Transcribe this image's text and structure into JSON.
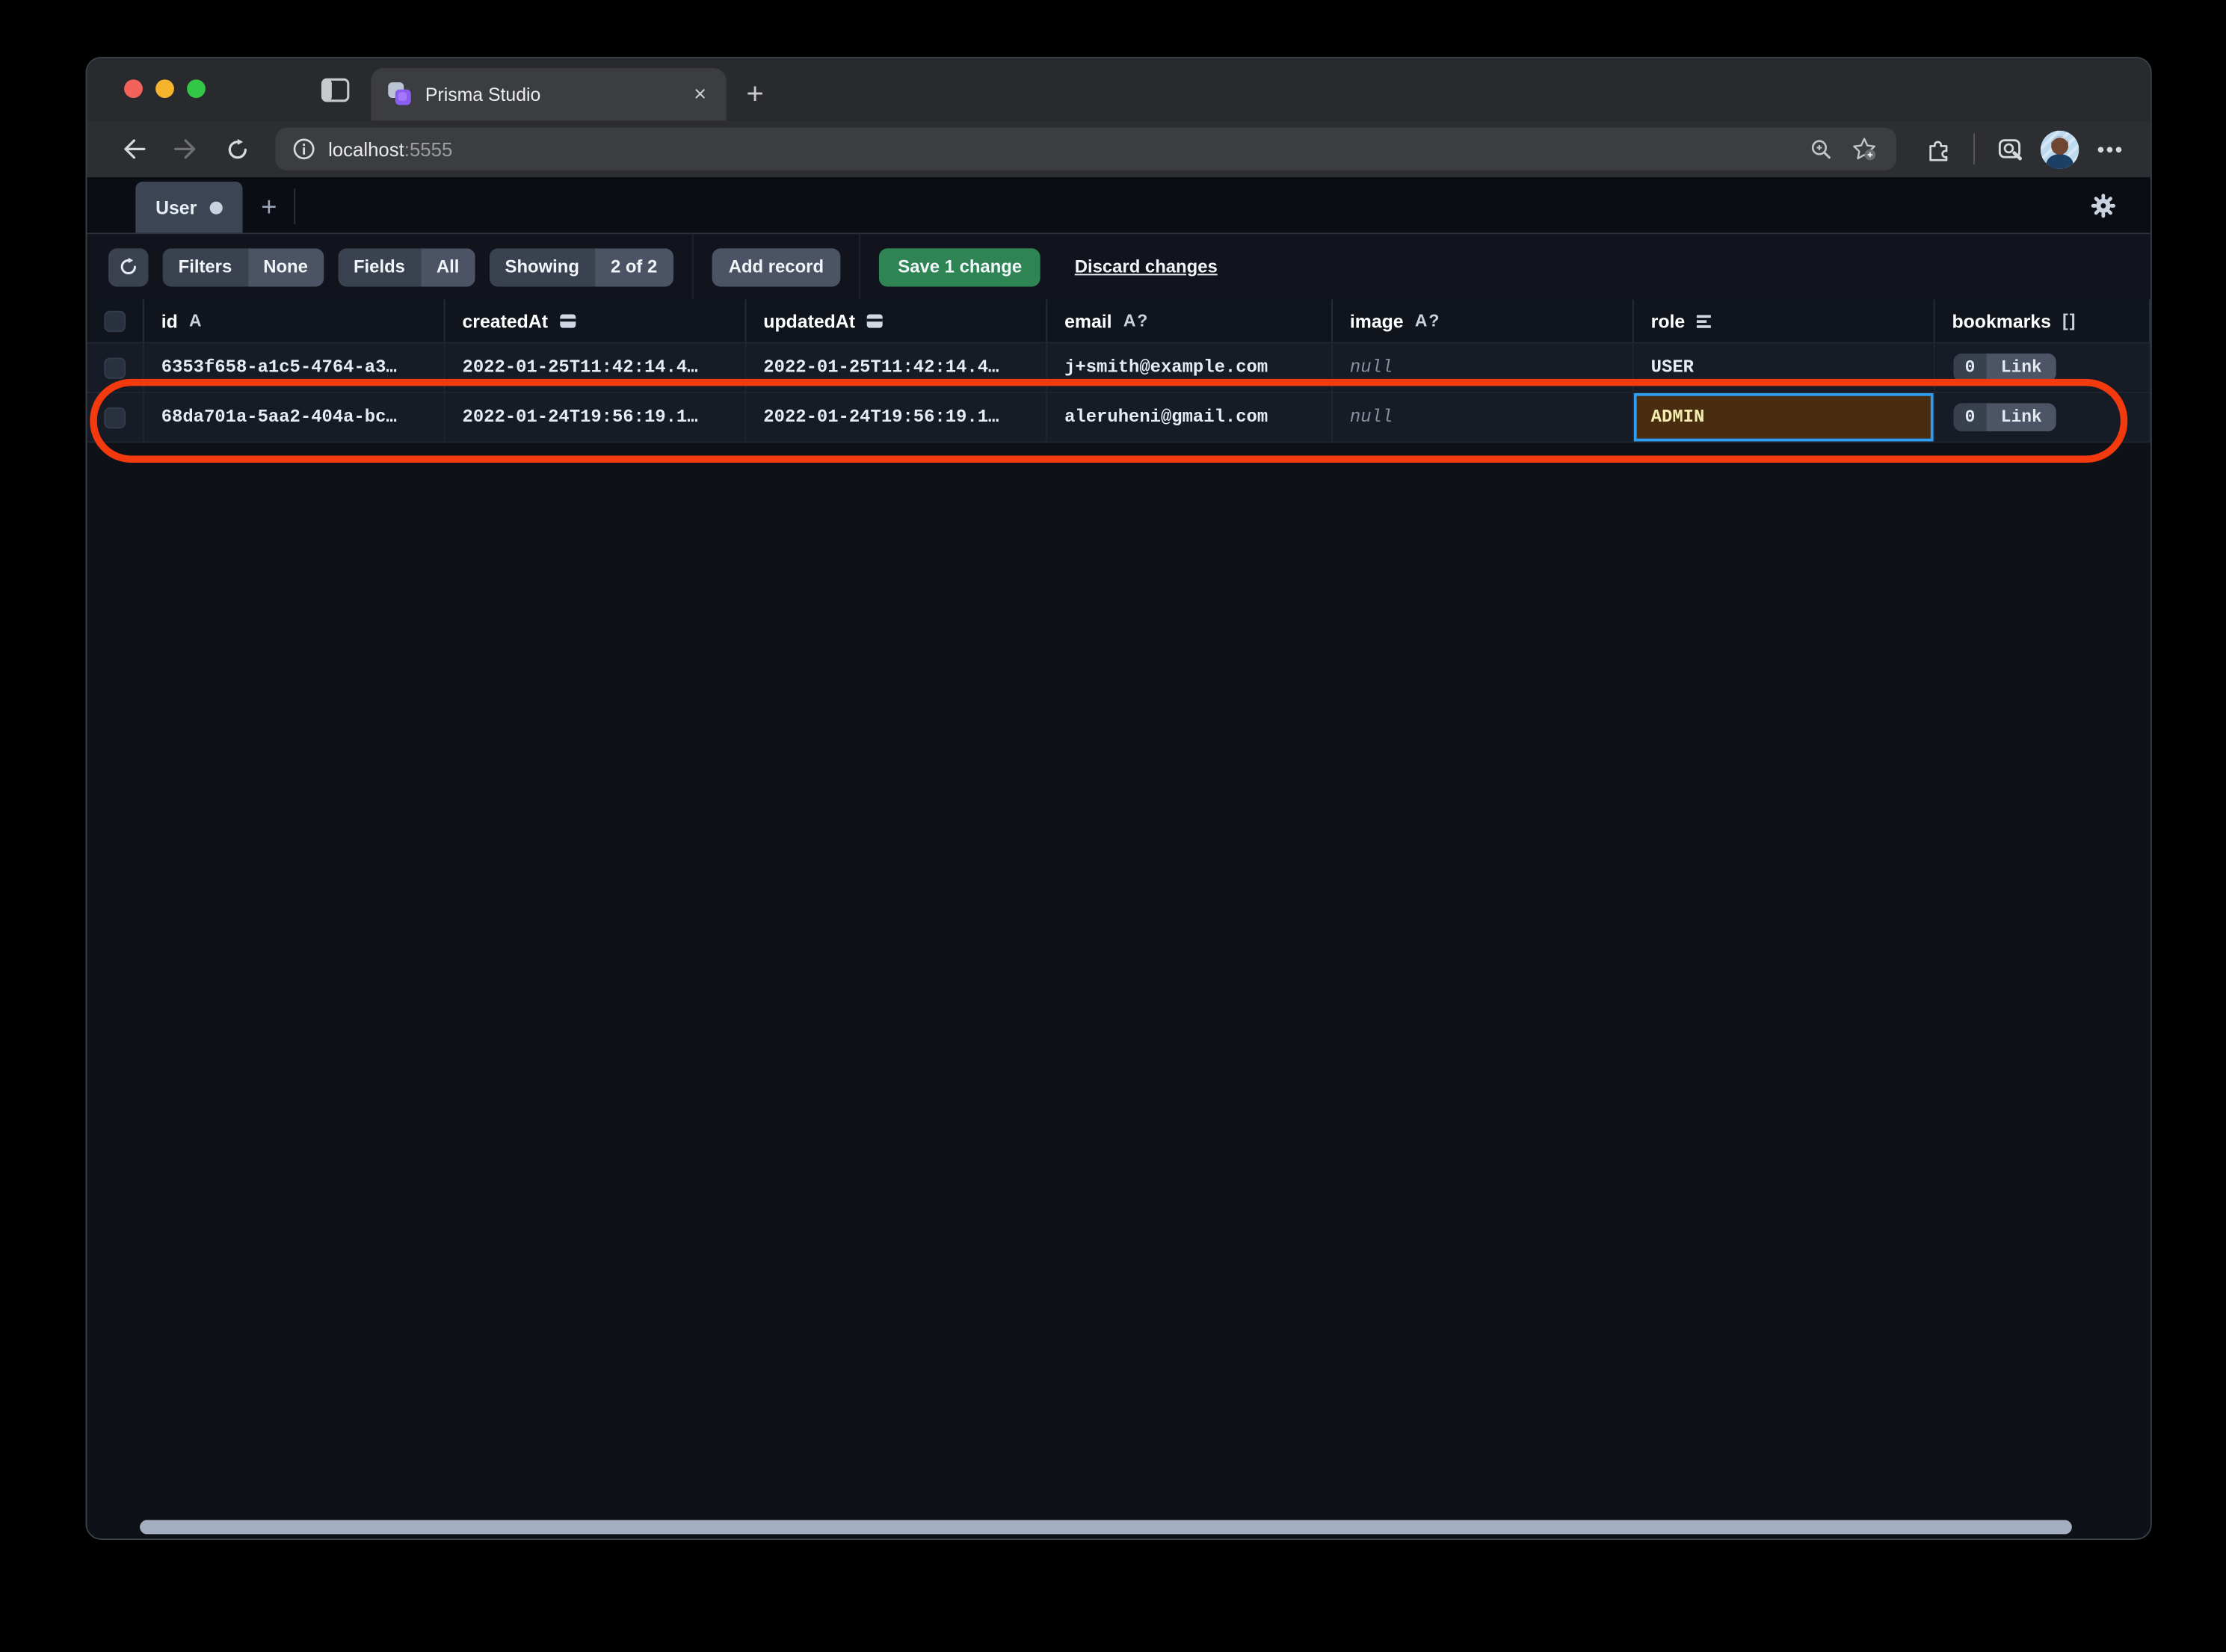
{
  "browser": {
    "tab_title": "Prisma Studio",
    "tab_close": "×",
    "new_tab": "+",
    "url_host": "localhost",
    "url_port": ":5555"
  },
  "studio": {
    "model_tab_label": "User",
    "add_tab": "+",
    "toolbar": {
      "filters_label": "Filters",
      "filters_value": "None",
      "fields_label": "Fields",
      "fields_value": "All",
      "showing_label": "Showing",
      "showing_value": "2 of 2",
      "add_record_label": "Add record",
      "save_label": "Save 1 change",
      "discard_label": "Discard changes"
    },
    "table": {
      "columns": [
        {
          "label": "id",
          "type_glyph": "A"
        },
        {
          "label": "createdAt",
          "type_icon": "calendar"
        },
        {
          "label": "updatedAt",
          "type_icon": "calendar"
        },
        {
          "label": "email",
          "type_glyph": "A?"
        },
        {
          "label": "image",
          "type_glyph": "A?"
        },
        {
          "label": "role",
          "type_icon": "enum-list"
        },
        {
          "label": "bookmarks",
          "type_glyph": "[]"
        }
      ],
      "rows": [
        {
          "id": "6353f658-a1c5-4764-a3…",
          "createdAt": "2022-01-25T11:42:14.4…",
          "updatedAt": "2022-01-25T11:42:14.4…",
          "email": "j+smith@example.com",
          "image": "null",
          "role": "USER",
          "role_state": "default",
          "bookmarks": {
            "count": "0",
            "link": "Link"
          }
        },
        {
          "id": "68da701a-5aa2-404a-bc…",
          "createdAt": "2022-01-24T19:56:19.1…",
          "updatedAt": "2022-01-24T19:56:19.1…",
          "email": "aleruheni@gmail.com",
          "image": "null",
          "role": "ADMIN",
          "role_state": "edited-selected",
          "bookmarks": {
            "count": "0",
            "link": "Link"
          }
        }
      ]
    }
  },
  "colors": {
    "save_button_green": "#2e8452",
    "edited_cell_background": "#4a2d10",
    "edited_cell_border": "#2f9ef2",
    "edited_cell_text": "#f3edae",
    "annotation_red": "#f23a0e",
    "prisma_purple": "#8a5cf0",
    "active_segment": "#4b5364",
    "scrollbar_thumb": "#a3aec0"
  }
}
